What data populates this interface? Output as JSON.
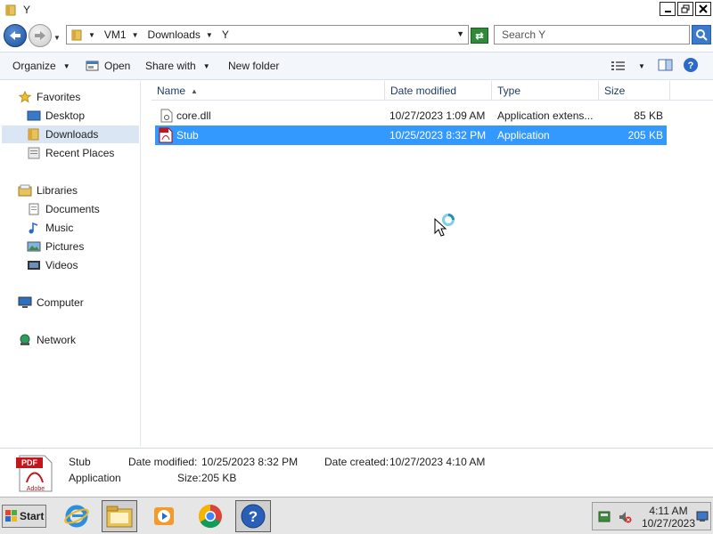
{
  "window": {
    "title": "Y"
  },
  "address": {
    "crumbs": [
      "VM1",
      "Downloads",
      "Y"
    ],
    "search_placeholder": "Search Y"
  },
  "toolbar": {
    "organize": "Organize",
    "open": "Open",
    "share_with": "Share with",
    "new_folder": "New folder"
  },
  "nav": {
    "favorites": "Favorites",
    "desktop": "Desktop",
    "downloads": "Downloads",
    "recent_places": "Recent Places",
    "libraries": "Libraries",
    "documents": "Documents",
    "music": "Music",
    "pictures": "Pictures",
    "videos": "Videos",
    "computer": "Computer",
    "network": "Network"
  },
  "columns": {
    "name": "Name",
    "date_modified": "Date modified",
    "type": "Type",
    "size": "Size"
  },
  "files": [
    {
      "name": "core.dll",
      "date": "10/27/2023 1:09 AM",
      "type": "Application extens...",
      "size": "85 KB",
      "icon": "dll-file-icon"
    },
    {
      "name": "Stub",
      "date": "10/25/2023 8:32 PM",
      "type": "Application",
      "size": "205 KB",
      "icon": "pdf-file-icon"
    }
  ],
  "details": {
    "name": "Stub",
    "type": "Application",
    "date_modified_label": "Date modified:",
    "date_modified": "10/25/2023 8:32 PM",
    "date_created_label": "Date created:",
    "date_created": "10/27/2023 4:10 AM",
    "size_label": "Size:",
    "size": "205 KB",
    "thumb_text_top": "PDF",
    "thumb_text_bottom": "Adobe"
  },
  "taskbar": {
    "start": "Start",
    "time": "4:11 AM",
    "date": "10/27/2023"
  },
  "colors": {
    "selection": "#3399ff",
    "nav_selected": "#dbe6f4",
    "toolbar_bg": "#f3f6fb"
  }
}
